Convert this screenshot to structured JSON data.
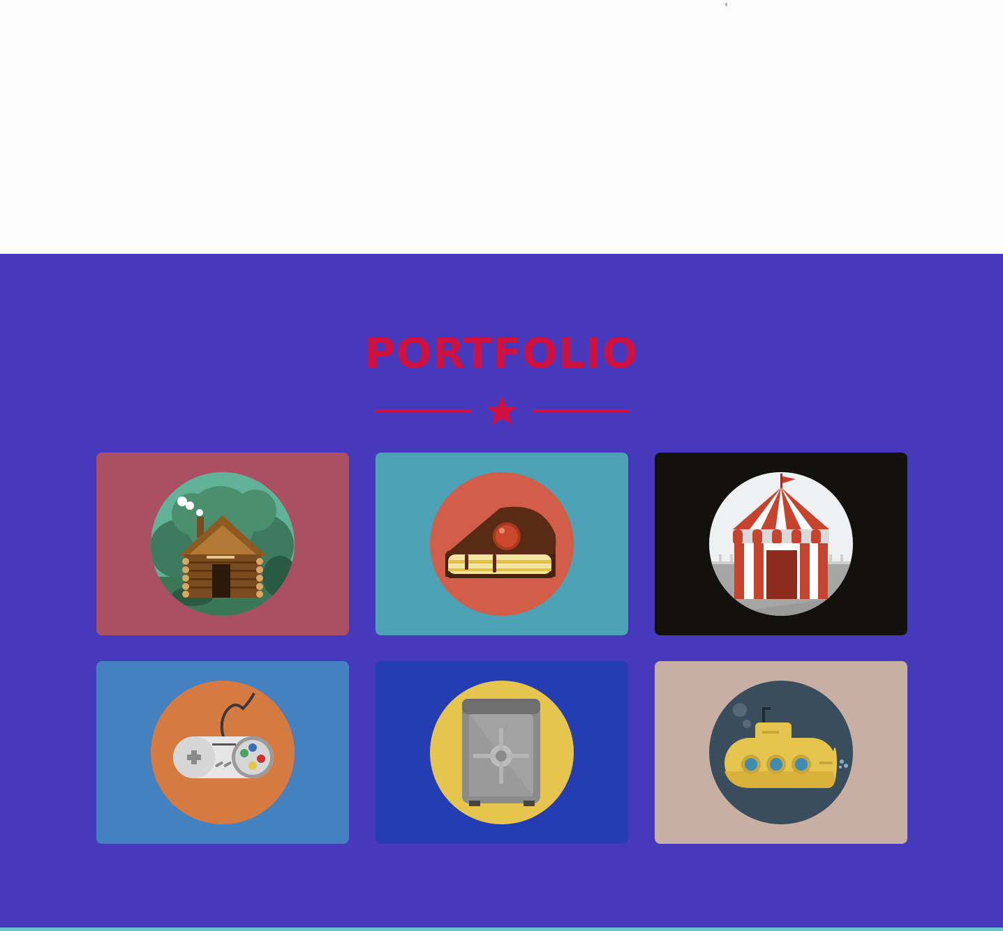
{
  "header": {
    "title": "PORTFOLIO"
  },
  "colors": {
    "section_bg": "#4639bb",
    "accent": "#d0103f",
    "footer_strip": "#6cc3d0"
  },
  "portfolio": {
    "items": [
      {
        "icon": "log-cabin-icon",
        "bg": "#ab4f62",
        "circle": "#62b29a"
      },
      {
        "icon": "cake-slice-icon",
        "bg": "#4da3b5",
        "circle": "#d25e4a"
      },
      {
        "icon": "circus-tent-icon",
        "bg": "#12110e",
        "circle": "#eef0f1"
      },
      {
        "icon": "game-controller-icon",
        "bg": "#4381c1",
        "circle": "#d57a40"
      },
      {
        "icon": "safe-icon",
        "bg": "#243db2",
        "circle": "#e6c54f"
      },
      {
        "icon": "submarine-icon",
        "bg": "#c7b0a3",
        "circle": "#3a4d5d"
      }
    ]
  }
}
